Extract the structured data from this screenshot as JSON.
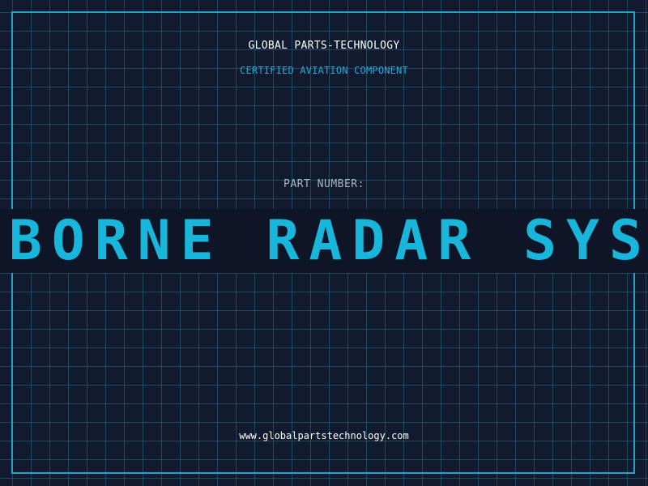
{
  "header": {
    "company": "GLOBAL PARTS-TECHNOLOGY",
    "subtitle": "CERTIFIED AVIATION COMPONENT"
  },
  "part": {
    "label": "PART NUMBER:",
    "value": "AIRBORNE RADAR SYSTEMS FU"
  },
  "footer": {
    "url": "www.globalpartstechnology.com"
  },
  "colors": {
    "background": "#111a2e",
    "grid": "#286e82",
    "accent": "#1fa6c8",
    "part_text": "#19b6dc"
  }
}
